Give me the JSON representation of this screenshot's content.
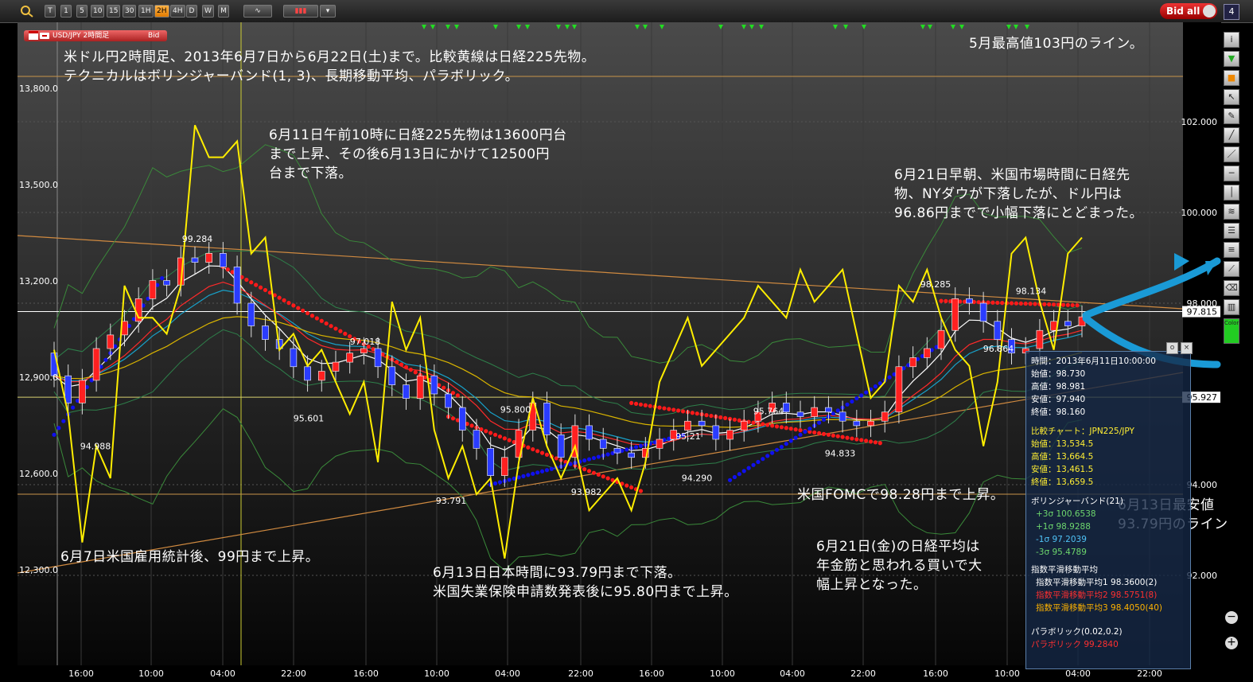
{
  "toolbar": {
    "timeframes": [
      "T",
      "1",
      "5",
      "10",
      "15",
      "30",
      "1H",
      "2H",
      "4H",
      "D",
      "W",
      "M"
    ],
    "active_timeframe": "2H",
    "bid_all_label": "Bid all",
    "window_count": "4"
  },
  "legend": {
    "symbol": "USD/JPY 2時間足",
    "price_type": "Bid"
  },
  "annotations": {
    "title": "米ドル円2時間足、2013年6月7日から6月22日(土)まで。比較黄線は日経225先物。\nテクニカルはボリンジャーバンド(1, 3)、長期移動平均、パラボリック。",
    "may_high": "5月最高値103円のライン。",
    "jun11": "6月11日午前10時に日経225先物は13600円台\nまで上昇、その後6月13日にかけて12500円\n台まで下落。",
    "jun21_morning": "6月21日早朝、米国市場時間に日経先\n物、NYダウが下落したが、ドル円は\n96.86円までで小幅下落にとどまった。",
    "jun7": "6月7日米国雇用統計後、99円まで上昇。",
    "jun13": "6月13日日本時間に93.79円まで下落。\n米国失業保険申請数発表後に95.80円まで上昇。",
    "fomc": "米国FOMCで98.28円まで上昇。",
    "jun21_nikkei": "6月21日(金)の日経平均は\n年金筋と思われる買いで大\n幅上昇となった。",
    "jun13_low": "6月13日最安値\n93.79円のライン"
  },
  "info_box": {
    "time": "時間：2013年6月11日10:00:00",
    "open": "始値：98.730",
    "high": "高値：98.981",
    "low": "安値：97.940",
    "close": "終値：98.160",
    "compare_title": "比較チャート：JPN225/JPY",
    "c_open": "始値：13,534.5",
    "c_high": "高値：13,664.5",
    "c_low": "安値：13,461.5",
    "c_close": "終値：13,659.5",
    "bb_title": "ボリンジャーバンド(21)",
    "bb_p3": "+3σ 100.6538",
    "bb_p1": "+1σ 98.9288",
    "bb_m1": "-1σ 97.2039",
    "bb_m3": "-3σ 95.4789",
    "ema_title": "指数平滑移動平均",
    "ema1": "指数平滑移動平均1 98.3600(2)",
    "ema2": "指数平滑移動平均2 98.5751(8)",
    "ema3": "指数平滑移動平均3 98.4050(40)",
    "psar_title": "パラボリック(0.02,0.2)",
    "psar": "パラボリック 99.2840"
  },
  "chart_data": {
    "type": "candlestick",
    "x_tick_labels": [
      "16:00",
      "10:00",
      "04:00",
      "22:00",
      "16:00",
      "10:00",
      "04:00",
      "22:00",
      "16:00",
      "10:00",
      "04:00",
      "22:00",
      "16:00",
      "10:00",
      "04:00",
      "22:00"
    ],
    "right_axis": {
      "label_values": [
        102.0,
        100.0,
        98.0,
        94.0,
        92.0
      ],
      "labels": [
        "102.000",
        "100.000",
        "98.000",
        "94.000",
        "92.000"
      ],
      "current_price": "97.815",
      "second_price": "95.927",
      "range": [
        90.0,
        103.5
      ]
    },
    "left_axis": {
      "label_values": [
        13800,
        13500,
        13200,
        12900,
        12600,
        12300
      ],
      "labels": [
        "13,800.0",
        "13,500.0",
        "13,200.0",
        "12,900.0",
        "12,600.0",
        "12,300.0"
      ]
    },
    "usdjpy_candles_close": [
      96.4,
      95.8,
      96.3,
      97.0,
      97.3,
      97.6,
      98.1,
      98.5,
      98.4,
      99.0,
      98.9,
      99.1,
      98.8,
      98.0,
      97.5,
      97.2,
      97.0,
      96.6,
      96.3,
      96.5,
      96.7,
      96.9,
      97.0,
      96.6,
      96.2,
      95.9,
      96.4,
      96.0,
      95.7,
      95.2,
      94.8,
      94.2,
      94.6,
      95.2,
      95.8,
      95.1,
      94.6,
      95.3,
      95.0,
      94.8,
      94.7,
      94.6,
      94.8,
      95.0,
      95.2,
      95.4,
      95.3,
      95.0,
      95.2,
      95.4,
      95.6,
      95.8,
      95.6,
      95.5,
      95.7,
      95.6,
      95.4,
      95.3,
      95.4,
      95.6,
      96.6,
      96.8,
      97.0,
      97.4,
      98.1,
      98.0,
      97.6,
      97.2,
      96.9,
      97.0,
      97.4,
      97.6,
      97.5,
      97.7
    ],
    "price_labels": [
      {
        "text": "99.284",
        "value": 99.284
      },
      {
        "text": "94.988",
        "value": 94.988
      },
      {
        "text": "97.018",
        "value": 97.018
      },
      {
        "text": "95.601",
        "value": 95.601
      },
      {
        "text": "95.800",
        "value": 95.8
      },
      {
        "text": "93.791",
        "value": 93.791
      },
      {
        "text": "93.982",
        "value": 93.982
      },
      {
        "text": "95.764",
        "value": 95.764
      },
      {
        "text": "95.21",
        "value": 95.21
      },
      {
        "text": "94.290",
        "value": 94.29
      },
      {
        "text": "94.833",
        "value": 94.833
      },
      {
        "text": "98.285",
        "value": 98.285
      },
      {
        "text": "98.134",
        "value": 98.134
      },
      {
        "text": "96.864",
        "value": 96.864
      }
    ],
    "horizontal_lines": [
      {
        "name": "may-high-103",
        "value": 103.0,
        "color": "#c8934a"
      },
      {
        "name": "current-price",
        "value": 97.815,
        "color": "#ffffff"
      },
      {
        "name": "jun13-low",
        "value": 93.79,
        "color": "#c8934a"
      }
    ],
    "colors": {
      "bull": "#ff2020",
      "bear": "#2a3cff",
      "nikkei": "#ffee00",
      "psar_high": "#ff1a1a",
      "psar_low": "#1010ee",
      "bb_outer": "#3a8a3a",
      "bb_mid": "#18a0c8",
      "ema_slow": "#d9b400",
      "grid": "#555555"
    }
  }
}
